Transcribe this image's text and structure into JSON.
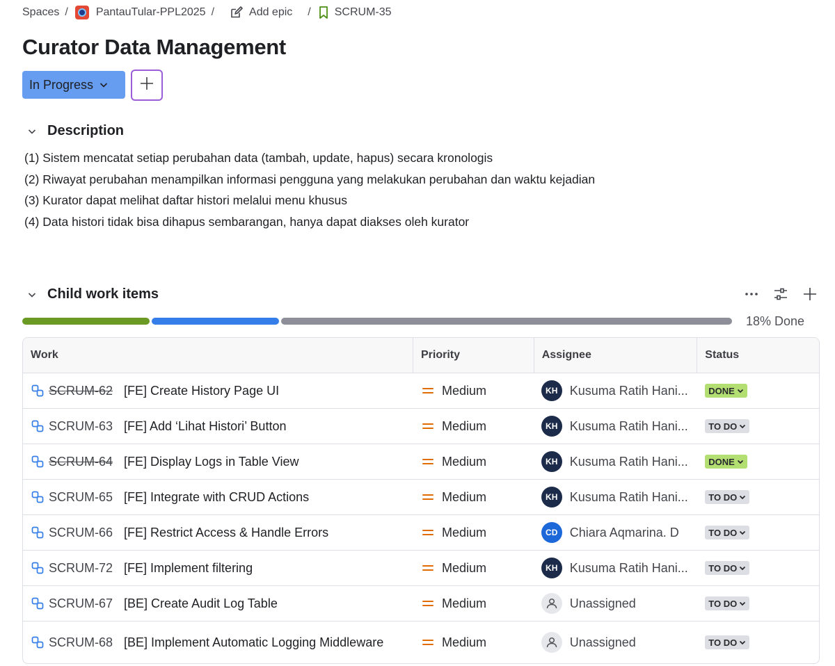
{
  "breadcrumb": {
    "spaces": "Spaces",
    "project": "PantauTular-PPL2025",
    "add_epic": "Add epic",
    "issue_key": "SCRUM-35"
  },
  "issue": {
    "title": "Curator Data Management",
    "status": "In Progress"
  },
  "description": {
    "heading": "Description",
    "lines": [
      "(1) Sistem mencatat setiap perubahan data (tambah, update, hapus) secara kronologis",
      "(2) Riwayat perubahan menampilkan informasi pengguna yang melakukan perubahan dan waktu kejadian",
      "(3) Kurator dapat melihat daftar histori melalui menu khusus",
      "(4) Data histori tidak bisa dihapus sembarangan, hanya dapat diakses oleh kurator"
    ]
  },
  "child_items": {
    "heading": "Child work items",
    "progress_label": "18% Done",
    "progress": {
      "done_percent": 18,
      "in_progress_percent": 18
    },
    "colors": {
      "done": "#6a9a23",
      "in_progress": "#357de8",
      "todo": "#8c8f97"
    },
    "columns": [
      "Work",
      "Priority",
      "Assignee",
      "Status"
    ],
    "rows": [
      {
        "key": "SCRUM-62",
        "summary": "[FE] Create History Page UI",
        "priority": "Medium",
        "initials": "KH",
        "assignee": "Kusuma Ratih Hani...",
        "status": "DONE"
      },
      {
        "key": "SCRUM-63",
        "summary": "[FE] Add ‘Lihat Histori’ Button",
        "priority": "Medium",
        "initials": "KH",
        "assignee": "Kusuma Ratih Hani...",
        "status": "TO DO"
      },
      {
        "key": "SCRUM-64",
        "summary": "[FE] Display Logs in Table View",
        "priority": "Medium",
        "initials": "KH",
        "assignee": "Kusuma Ratih Hani...",
        "status": "DONE"
      },
      {
        "key": "SCRUM-65",
        "summary": "[FE] Integrate with CRUD Actions",
        "priority": "Medium",
        "initials": "KH",
        "assignee": "Kusuma Ratih Hani...",
        "status": "TO DO"
      },
      {
        "key": "SCRUM-66",
        "summary": "[FE] Restrict Access & Handle Errors",
        "priority": "Medium",
        "initials": "CD",
        "assignee": "Chiara Aqmarina. D",
        "status": "TO DO"
      },
      {
        "key": "SCRUM-72",
        "summary": "[FE] Implement filtering",
        "priority": "Medium",
        "initials": "KH",
        "assignee": "Kusuma Ratih Hani...",
        "status": "TO DO"
      },
      {
        "key": "SCRUM-67",
        "summary": "[BE] Create Audit Log Table",
        "priority": "Medium",
        "initials": "",
        "assignee": "Unassigned",
        "status": "TO DO"
      },
      {
        "key": "SCRUM-68",
        "summary": "[BE] Implement Automatic Logging Middleware",
        "priority": "Medium",
        "initials": "",
        "assignee": "Unassigned",
        "status": "TO DO"
      }
    ]
  }
}
